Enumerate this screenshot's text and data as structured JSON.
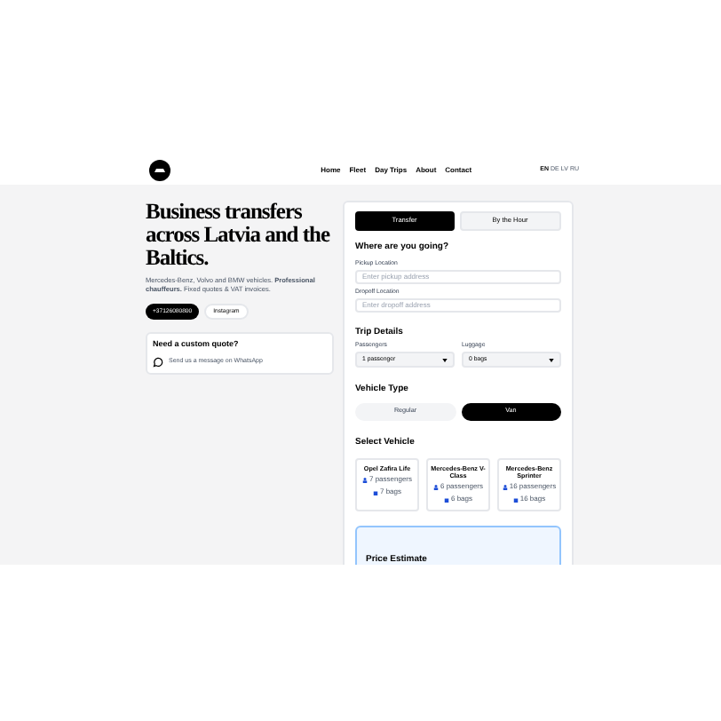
{
  "nav": {
    "links": [
      "Home",
      "Fleet",
      "Day Trips",
      "About",
      "Contact"
    ],
    "languages": [
      "EN",
      "DE",
      "LV",
      "RU"
    ]
  },
  "hero": {
    "title": "Business transfers across Latvia and the Baltics.",
    "description": "Mercedes-Benz, Volvo and BMW vehicles. **Professional chauffeurs.** Fixed quotes & VAT invoices.",
    "buttons": [
      {
        "label": "+37126080800",
        "kind": "primary"
      },
      {
        "label": "Instagram",
        "kind": "secondary"
      }
    ],
    "quote_card": {
      "title": "Need a custom quote?",
      "link": "Send us a message on WhatsApp"
    }
  },
  "booking": {
    "tabs": [
      {
        "label": "Transfer",
        "selected": true
      },
      {
        "label": "By the Hour",
        "selected": false
      }
    ],
    "where_title": "Where are you going?",
    "fields": [
      {
        "label": "Pickup Location",
        "placeholder": "Enter pickup address"
      },
      {
        "label": "Dropoff Location",
        "placeholder": "Enter dropoff address"
      }
    ],
    "trip_title": "Trip Details",
    "selects": [
      {
        "label": "Passengers",
        "value": "1 passenger"
      },
      {
        "label": "Luggage",
        "value": "0 bags"
      }
    ],
    "vehicle_type_title": "Vehicle Type",
    "vehicle_types": [
      {
        "label": "Regular",
        "selected": false
      },
      {
        "label": "Van",
        "selected": true
      }
    ],
    "select_vehicle_title": "Select Vehicle",
    "vehicles": [
      {
        "name": "Opel Zafira Life",
        "passengers": "7 passengers",
        "bags": "7 bags"
      },
      {
        "name": "Mercedes-Benz V-Class",
        "passengers": "6 passengers",
        "bags": "6 bags"
      },
      {
        "name": "Mercedes-Benz Sprinter",
        "passengers": "16 passengers",
        "bags": "16 bags"
      }
    ],
    "estimate_title": "Price Estimate"
  }
}
